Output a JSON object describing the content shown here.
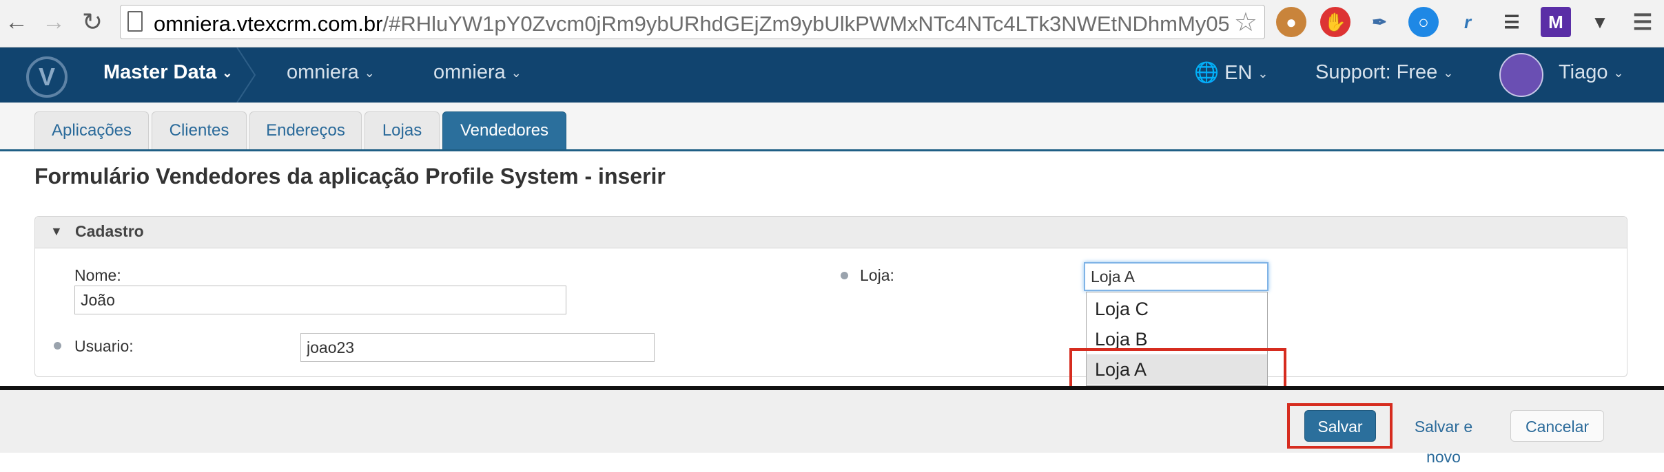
{
  "browser": {
    "url_host": "omniera.vtexcrm.com.br",
    "url_path": "/#RHluYW1pY0Zvcm0jRm9ybURhdGEjZm9ybUlkPWMxNTc4NTc4LTk3NWEtNDhmMy05ZTE…",
    "icons": [
      "back-icon",
      "forward-icon",
      "reload-icon",
      "page-icon",
      "bookmark-star-icon",
      "cookie-ext-icon",
      "stop-ext-icon",
      "eyedropper-ext-icon",
      "circle-ext-icon",
      "r-ext-icon",
      "wrench-ext-icon",
      "m-ext-icon",
      "pocket-ext-icon",
      "menu-icon"
    ]
  },
  "header": {
    "logo": "V",
    "app_name": "Master Data",
    "crumb1": "omniera",
    "crumb2": "omniera",
    "language": "EN",
    "support": "Support: Free",
    "user": "Tiago",
    "colors": {
      "bar": "#11446f",
      "accent": "#2b6f9c"
    }
  },
  "tabs": [
    {
      "label": "Aplicações"
    },
    {
      "label": "Clientes"
    },
    {
      "label": "Endereços"
    },
    {
      "label": "Lojas"
    },
    {
      "label": "Vendedores",
      "active": true
    }
  ],
  "page": {
    "title": "Formulário Vendedores da aplicação Profile System - inserir"
  },
  "panel": {
    "title": "Cadastro",
    "nome_label": "Nome:",
    "nome_value": "João",
    "usuario_label": "Usuario:",
    "usuario_value": "joao23",
    "loja_label": "Loja:",
    "loja_value": "Loja A",
    "loja_options": [
      "Loja C",
      "Loja B",
      "Loja A"
    ]
  },
  "footer": {
    "save": "Salvar",
    "save_new": "Salvar e novo",
    "cancel": "Cancelar"
  }
}
